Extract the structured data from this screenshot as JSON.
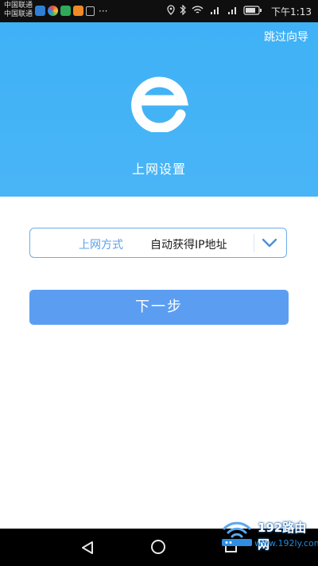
{
  "statusbar": {
    "carrier1": "中国联通",
    "carrier2": "中国联通",
    "time": "下午1:13",
    "notif_icons": [
      "app-icon-blue",
      "app-icon-multicolor",
      "app-icon-green-heart",
      "app-icon-orange",
      "app-icon-lock"
    ],
    "system_icons": [
      "location-icon",
      "bluetooth-icon",
      "wifi-icon",
      "signal-4g-icon",
      "signal-2g-icon",
      "battery-icon"
    ]
  },
  "header": {
    "skip_label": "跳过向导",
    "title": "上网设置",
    "logo_icon": "e-logo-icon",
    "bg_color": "#45b3f7"
  },
  "form": {
    "select_label": "上网方式",
    "select_value": "自动获得IP地址",
    "dropdown_icon": "chevron-down-icon"
  },
  "next_button": {
    "label": "下一步",
    "color": "#5b9ef1"
  },
  "navbar": {
    "icons": [
      "back-icon",
      "home-icon",
      "recents-icon"
    ]
  },
  "watermark": {
    "big_text": "192路由网",
    "small_text": "www.192ly.com"
  }
}
